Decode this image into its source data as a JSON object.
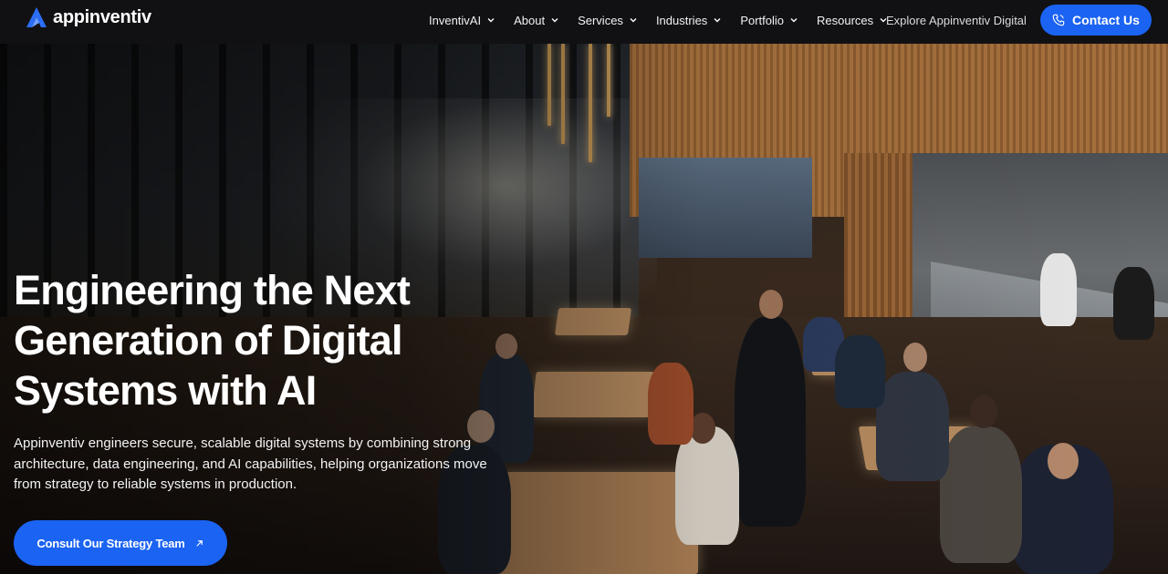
{
  "brand": {
    "name": "appinventiv",
    "logo_icon": "appinventiv-logo-icon"
  },
  "nav": {
    "items": [
      {
        "label": "InventivAI",
        "icon": "chevron-down-icon"
      },
      {
        "label": "About",
        "icon": "chevron-down-icon"
      },
      {
        "label": "Services",
        "icon": "chevron-down-icon"
      },
      {
        "label": "Industries",
        "icon": "chevron-down-icon"
      },
      {
        "label": "Portfolio",
        "icon": "chevron-down-icon"
      },
      {
        "label": "Resources",
        "icon": "chevron-down-icon"
      }
    ],
    "explore_label": "Explore Appinventiv Digital",
    "contact": {
      "label": "Contact Us",
      "icon": "phone-icon"
    }
  },
  "hero": {
    "headline_lines": [
      "Engineering the Next",
      "Generation of Digital",
      "Systems with AI"
    ],
    "description": "Appinventiv engineers secure, scalable digital systems by combining strong architecture, data engineering, and AI capabilities, helping organizations move from strategy to reliable systems in production.",
    "cta": {
      "label": "Consult Our Strategy Team",
      "icon": "arrow-up-right-icon"
    },
    "background": "restaurant-scene-image"
  },
  "colors": {
    "accent": "#1b63f2",
    "header_bg": "#111114",
    "text": "#ffffff"
  }
}
